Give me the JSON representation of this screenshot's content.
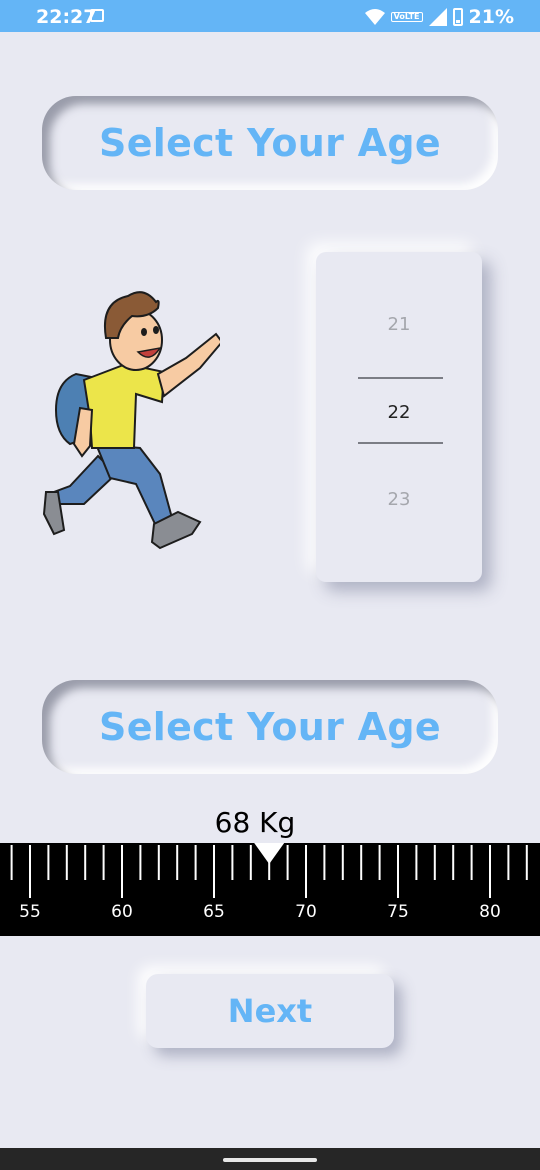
{
  "status_bar": {
    "time": "22:27",
    "volte": "VoLTE",
    "battery": "21%",
    "icons": [
      "image-icon",
      "wifi-icon",
      "volte-icon",
      "signal-icon",
      "battery-icon"
    ]
  },
  "age_section": {
    "title": "Select Your Age",
    "picker": {
      "previous": "21",
      "selected": "22",
      "next": "23"
    }
  },
  "weight_section": {
    "title": "Select Your Age",
    "value_label": "68 Kg",
    "ruler": {
      "min": 54,
      "max": 82,
      "selected": 68,
      "labels": [
        "55",
        "60",
        "65",
        "70",
        "75",
        "80"
      ]
    }
  },
  "next_button": {
    "label": "Next"
  },
  "colors": {
    "accent": "#64b5f6",
    "background": "#e8e9f2",
    "ruler": "#000000"
  }
}
